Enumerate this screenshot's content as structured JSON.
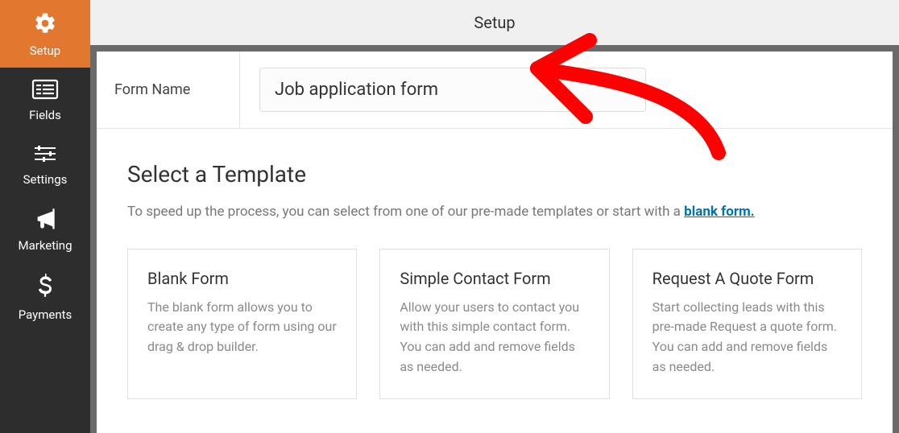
{
  "sidebar": {
    "items": [
      {
        "label": "Setup",
        "icon": "gear-icon"
      },
      {
        "label": "Fields",
        "icon": "fields-icon"
      },
      {
        "label": "Settings",
        "icon": "sliders-icon"
      },
      {
        "label": "Marketing",
        "icon": "bullhorn-icon"
      },
      {
        "label": "Payments",
        "icon": "dollar-icon"
      }
    ]
  },
  "header": {
    "title": "Setup"
  },
  "form": {
    "name_label": "Form Name",
    "name_value": "Job application form"
  },
  "templates": {
    "heading": "Select a Template",
    "subtitle_before_link": "To speed up the process, you can select from one of our pre-made templates or start with a ",
    "blank_form_link": "blank form.",
    "cards": [
      {
        "title": "Blank Form",
        "desc": "The blank form allows you to create any type of form using our drag & drop builder."
      },
      {
        "title": "Simple Contact Form",
        "desc": "Allow your users to contact you with this simple contact form. You can add and remove fields as needed."
      },
      {
        "title": "Request A Quote Form",
        "desc": "Start collecting leads with this pre-made Request a quote form. You can add and remove fields as needed."
      }
    ]
  },
  "annotation": {
    "type": "arrow",
    "color": "#ff0000"
  }
}
